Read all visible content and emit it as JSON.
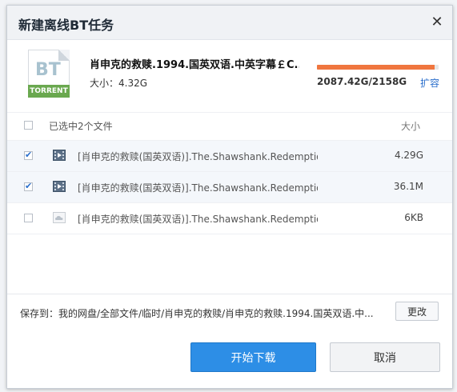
{
  "window": {
    "title": "新建离线BT任务",
    "close_icon": "close-icon"
  },
  "torrent": {
    "icon_text": "BT",
    "icon_band_text": "TORRENT",
    "file_title": "肖申克的救赎.1994.国英双语.中英字幕￡C...",
    "size_label": "大小：4.32G"
  },
  "quota": {
    "used_fraction": 0.967,
    "text": "2087.42G/2158G",
    "expand_label": "扩容",
    "bar_color": "#f0763f"
  },
  "list": {
    "header_label": "已选中2个文件",
    "size_header": "大小",
    "items": [
      {
        "name": "[肖申克的救赎(国英双语)].The.Shawshank.Redemptio...",
        "size": "4.29G",
        "checked": true,
        "icon": "video-file-icon"
      },
      {
        "name": "[肖申克的救赎(国英双语)].The.Shawshank.Redemptio...",
        "size": "36.1M",
        "checked": true,
        "icon": "video-file-icon"
      },
      {
        "name": "[肖申克的救赎(国英双语)].The.Shawshank.Redemptio...",
        "size": "6KB",
        "checked": false,
        "icon": "cloud-file-icon"
      }
    ]
  },
  "save": {
    "path_label": "保存到：我的网盘/全部文件/临时/肖申克的救赎/肖申克的救赎.1994.国英双语.中...",
    "change_button": "更改"
  },
  "actions": {
    "start_label": "开始下载",
    "cancel_label": "取消",
    "primary_color": "#2d8ee6"
  }
}
